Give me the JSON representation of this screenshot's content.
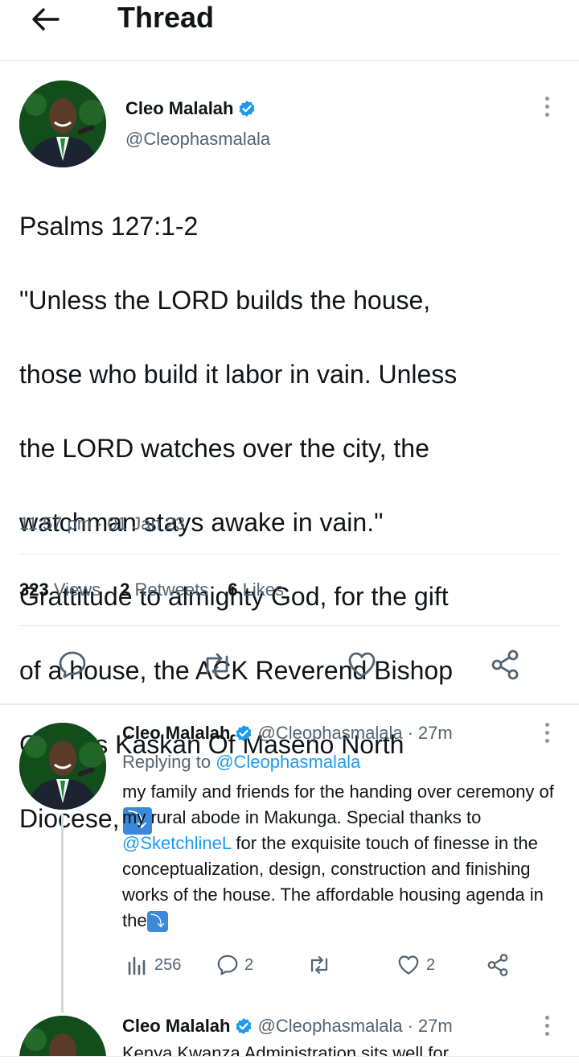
{
  "header": {
    "title": "Thread"
  },
  "main_tweet": {
    "name": "Cleo Malalah",
    "handle": "@Cleophasmalala",
    "text_lines": [
      "Psalms 127:1-2",
      "\"Unless the LORD builds the house,",
      "those who build it labor in vain. Unless",
      "the LORD watches over the city, the",
      "watchman stays awake in vain.\"",
      "Grattitude to almighty God, for the gift",
      "of a house, the ACK Reverend Bishop",
      "Charles Kaskan Of Maseno North",
      "Diocese,"
    ],
    "arrow": "⤵",
    "time": "11:57 pm · 01 Jan 23",
    "stats": {
      "views_count": "323",
      "views_label": "Views",
      "retweets_count": "2",
      "retweets_label": "Retweets",
      "likes_count": "6",
      "likes_label": "Likes"
    }
  },
  "reply_1": {
    "name": "Cleo Malalah",
    "handle": "@Cleophasmalala",
    "time": "27m",
    "replying_prefix": "Replying to",
    "replying_handle": "@Cleophasmalala",
    "text_part1": "my family and friends for the handing over ceremony of my rural abode in Makunga. Special thanks to ",
    "mention": "@SketchlineL",
    "text_part2": " for the exquisite touch of finesse in the conceptualization, design, construction and finishing works of the house. The affordable housing agenda in the",
    "arrow": "⤵",
    "views": "256",
    "replies": "2",
    "likes": "2"
  },
  "reply_2": {
    "name": "Cleo Malalah",
    "handle": "@Cleophasmalala",
    "time": "27m",
    "text": "Kenya Kwanza Administration sits well for"
  },
  "colors": {
    "verified": "#1d9bf0",
    "link": "#1d9bf0",
    "muted": "#536471",
    "arrow_emoji": "#3b8ad9"
  }
}
